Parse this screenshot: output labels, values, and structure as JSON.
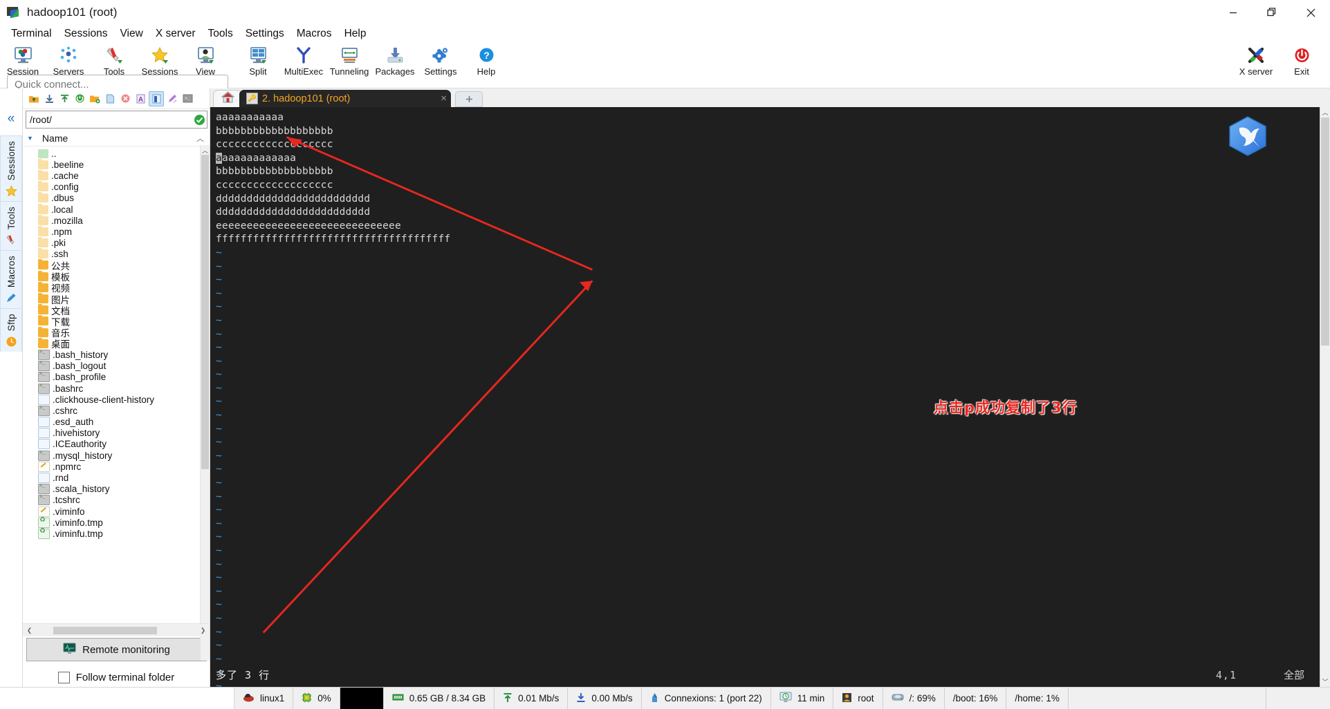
{
  "window": {
    "title": "hadoop101 (root)",
    "controls": {
      "minimize": "minimize-icon",
      "maximize": "maximize-icon",
      "close": "close-icon"
    }
  },
  "menubar": {
    "items": [
      "Terminal",
      "Sessions",
      "View",
      "X server",
      "Tools",
      "Settings",
      "Macros",
      "Help"
    ]
  },
  "toolbar": {
    "items": [
      {
        "label": "Session",
        "icon": "session-icon"
      },
      {
        "label": "Servers",
        "icon": "servers-icon"
      },
      {
        "label": "Tools",
        "icon": "tools-icon"
      },
      {
        "label": "Sessions",
        "icon": "sessions-star-icon"
      },
      {
        "label": "View",
        "icon": "view-icon"
      },
      {
        "label": "Split",
        "icon": "split-icon"
      },
      {
        "label": "MultiExec",
        "icon": "multiexec-icon"
      },
      {
        "label": "Tunneling",
        "icon": "tunneling-icon"
      },
      {
        "label": "Packages",
        "icon": "packages-icon"
      },
      {
        "label": "Settings",
        "icon": "settings-gear-icon"
      },
      {
        "label": "Help",
        "icon": "help-icon"
      }
    ],
    "right": [
      {
        "label": "X server",
        "icon": "x-server-icon"
      },
      {
        "label": "Exit",
        "icon": "exit-power-icon"
      }
    ]
  },
  "quick_connect": {
    "placeholder": "Quick connect..."
  },
  "ribbon": {
    "collapse": "«",
    "items": [
      {
        "label": "Sessions",
        "icon": "star-icon"
      },
      {
        "label": "Tools",
        "icon": "swiss-knife-icon"
      },
      {
        "label": "Macros",
        "icon": "pencil-icon"
      },
      {
        "label": "Sftp",
        "icon": "clock-icon"
      }
    ]
  },
  "sftp": {
    "toolbar_icons": [
      "go-up-icon",
      "download-icon",
      "upload-icon",
      "refresh-icon",
      "new-folder-icon",
      "new-file-icon",
      "delete-icon",
      "text-mode-icon",
      "binary-mode-icon",
      "quick-edit-icon",
      "terminal-icon"
    ],
    "path": "/root/",
    "path_status": "ok-icon",
    "column_header": "Name",
    "files": [
      {
        "name": "..",
        "icon": "up-folder-icon"
      },
      {
        "name": ".beeline",
        "icon": "folder-pale-icon"
      },
      {
        "name": ".cache",
        "icon": "folder-pale-icon"
      },
      {
        "name": ".config",
        "icon": "folder-pale-icon"
      },
      {
        "name": ".dbus",
        "icon": "folder-pale-icon"
      },
      {
        "name": ".local",
        "icon": "folder-pale-icon"
      },
      {
        "name": ".mozilla",
        "icon": "folder-pale-icon"
      },
      {
        "name": ".npm",
        "icon": "folder-pale-icon"
      },
      {
        "name": ".pki",
        "icon": "folder-pale-icon"
      },
      {
        "name": ".ssh",
        "icon": "folder-pale-icon"
      },
      {
        "name": "公共",
        "icon": "folder-icon"
      },
      {
        "name": "模板",
        "icon": "folder-icon"
      },
      {
        "name": "视频",
        "icon": "folder-icon"
      },
      {
        "name": "图片",
        "icon": "folder-icon"
      },
      {
        "name": "文档",
        "icon": "folder-icon"
      },
      {
        "name": "下载",
        "icon": "folder-icon"
      },
      {
        "name": "音乐",
        "icon": "folder-icon"
      },
      {
        "name": "桌面",
        "icon": "folder-icon"
      },
      {
        "name": ".bash_history",
        "icon": "shell-file-icon"
      },
      {
        "name": ".bash_logout",
        "icon": "shell-file-icon"
      },
      {
        "name": ".bash_profile",
        "icon": "shell-file-icon"
      },
      {
        "name": ".bashrc",
        "icon": "shell-file-icon"
      },
      {
        "name": ".clickhouse-client-history",
        "icon": "doc-file-icon"
      },
      {
        "name": ".cshrc",
        "icon": "shell-file-icon"
      },
      {
        "name": ".esd_auth",
        "icon": "doc-file-icon"
      },
      {
        "name": ".hivehistory",
        "icon": "doc-file-icon"
      },
      {
        "name": ".ICEauthority",
        "icon": "doc-file-icon"
      },
      {
        "name": ".mysql_history",
        "icon": "shell-file-icon"
      },
      {
        "name": ".npmrc",
        "icon": "edit-file-icon"
      },
      {
        "name": ".rnd",
        "icon": "doc-file-icon"
      },
      {
        "name": ".scala_history",
        "icon": "shell-file-icon"
      },
      {
        "name": ".tcshrc",
        "icon": "shell-file-icon"
      },
      {
        "name": ".viminfo",
        "icon": "edit-file-icon"
      },
      {
        "name": ".viminfo.tmp",
        "icon": "recycle-file-icon"
      },
      {
        "name": ".viminfu.tmp",
        "icon": "recycle-file-icon"
      }
    ],
    "remote_monitoring": "Remote monitoring",
    "follow_terminal_folder": "Follow terminal folder",
    "follow_checked": false
  },
  "tabs": {
    "home_icon": "home-icon",
    "active": {
      "label": "2. hadoop101 (root)",
      "icon": "key-icon",
      "close": "×"
    },
    "new_tab": "+"
  },
  "terminal": {
    "lines": [
      "aaaaaaaaaaa",
      "bbbbbbbbbbbbbbbbbbb",
      "ccccccccccccccccccc",
      "aaaaaaaaaaaa",
      "bbbbbbbbbbbbbbbbbbb",
      "ccccccccccccccccccc",
      "ddddddddddddddddddddddddd",
      "ddddddddddddddddddddddddd",
      "eeeeeeeeeeeeeeeeeeeeeeeeeeeeee",
      "ffffffffffffffffffffffffffffffffffffff"
    ],
    "cursor_line_index": 3,
    "tilde_rows": 34,
    "tilde_char": "~",
    "status_left": "多了 3 行",
    "status_position": "4,1",
    "status_right": "全部",
    "logo": "mobaxterm-bird-logo"
  },
  "annotation": {
    "text": "点击p成功复制了3行",
    "color": "#e8271f",
    "arrows": 2
  },
  "statusbar": {
    "items": [
      {
        "icon": "redhat-icon",
        "label": "linux1"
      },
      {
        "icon": "cpu-icon",
        "label": "0%"
      },
      {
        "icon": "black-box",
        "label": ""
      },
      {
        "icon": "ram-icon",
        "label": "0.65 GB / 8.34 GB"
      },
      {
        "icon": "upload-icon",
        "label": "0.01 Mb/s"
      },
      {
        "icon": "download-icon",
        "label": "0.00 Mb/s"
      },
      {
        "icon": "connection-icon",
        "label": "Connexions: 1 (port 22)"
      },
      {
        "icon": "uptime-icon",
        "label": "11 min"
      },
      {
        "icon": "user-icon",
        "label": "root"
      },
      {
        "icon": "disk-icon",
        "label": "/: 69%"
      },
      {
        "icon": "",
        "label": "/boot: 16%"
      },
      {
        "icon": "",
        "label": "/home: 1%"
      }
    ]
  }
}
